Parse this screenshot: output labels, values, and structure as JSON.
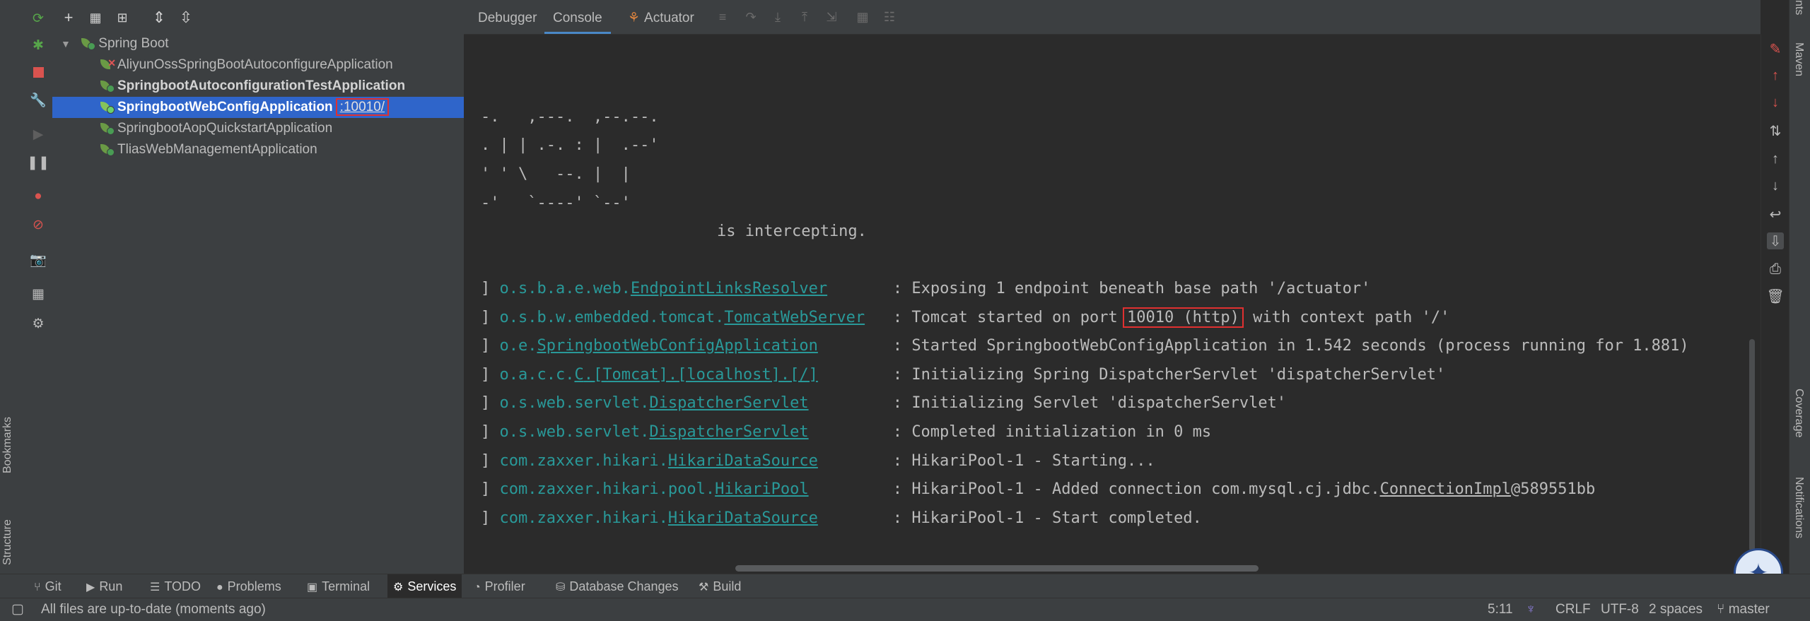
{
  "left_strip": {
    "bookmarks_label": "Bookmarks",
    "structure_label": "Structure"
  },
  "services": {
    "root_label": "Spring Boot",
    "apps": [
      {
        "name": "AliyunOssSpringBootAutoconfigureApplication",
        "status": "error"
      },
      {
        "name": "SpringbootAutoconfigurationTestApplication",
        "status": "stopped"
      },
      {
        "name": "SpringbootWebConfigApplication",
        "status": "running",
        "port": ":10010/"
      },
      {
        "name": "SpringbootAopQuickstartApplication",
        "status": "stopped"
      },
      {
        "name": "TliasWebManagementApplication",
        "status": "stopped"
      }
    ]
  },
  "console_tabs": {
    "debugger": "Debugger",
    "console": "Console",
    "actuator": "Actuator"
  },
  "console": {
    "ascii": [
      "-.   ,---.  ,--.--.",
      ". | | .-. : |  .--'",
      "' ' \\   --. |  |",
      "-'   `----' `--'"
    ],
    "intercept_line": "is intercepting.",
    "logs": [
      {
        "pkg": "o.s.b.a.e.web.",
        "cls": "EndpointLinksResolver",
        "pad": "      ",
        "msg": "Exposing 1 endpoint beneath base path '/actuator'"
      },
      {
        "pkg": "o.s.b.w.embedded.tomcat.",
        "cls": "TomcatWebServer",
        "pad": "  ",
        "msg_before": "Tomcat started on port ",
        "msg_boxed": "10010 (http)",
        "msg_after": " with context path '/'"
      },
      {
        "pkg": "o.e.",
        "cls": "SpringbootWebConfigApplication",
        "pad": "       ",
        "msg": "Started SpringbootWebConfigApplication in 1.542 seconds (process running for 1.881)"
      },
      {
        "pkg": "o.a.c.c.",
        "cls": "C",
        "pkg2": ".[Tomcat].[localhost].[/]",
        "pad": "       ",
        "msg": "Initializing Spring DispatcherServlet 'dispatcherServlet'"
      },
      {
        "pkg": "o.s.web.servlet.",
        "cls": "DispatcherServlet",
        "pad": "        ",
        "msg": "Initializing Servlet 'dispatcherServlet'"
      },
      {
        "pkg": "o.s.web.servlet.",
        "cls": "DispatcherServlet",
        "pad": "        ",
        "msg": "Completed initialization in 0 ms"
      },
      {
        "pkg": "com.zaxxer.hikari.",
        "cls": "HikariDataSource",
        "pad": "       ",
        "msg": "HikariPool-1 - Starting..."
      },
      {
        "pkg": "com.zaxxer.hikari.pool.",
        "cls": "HikariPool",
        "pad": "        ",
        "msg_before": "HikariPool-1 - Added connection com.mysql.cj.jdbc.",
        "msg_u": "ConnectionImpl",
        "msg_after": "@589551bb"
      },
      {
        "pkg": "com.zaxxer.hikari.",
        "cls": "HikariDataSource",
        "pad": "       ",
        "msg": "HikariPool-1 - Start completed."
      }
    ]
  },
  "right_strip": {
    "top_label": "nts",
    "maven_label": "Maven",
    "coverage_label": "Coverage",
    "notifications_label": "Notifications"
  },
  "tool_windows": [
    "Git",
    "Run",
    "TODO",
    "Problems",
    "Terminal",
    "Services",
    "Profiler",
    "Database Changes",
    "Build"
  ],
  "status": {
    "message": "All files are up-to-date (moments ago)",
    "position": "5:11",
    "line_sep": "CRLF",
    "encoding": "UTF-8",
    "indent": "2 spaces",
    "branch": "master"
  },
  "colors": {
    "selection": "#2f65ca",
    "logger": "#299999",
    "highlight_box": "#e03030",
    "spring_green": "#6a9a45"
  }
}
